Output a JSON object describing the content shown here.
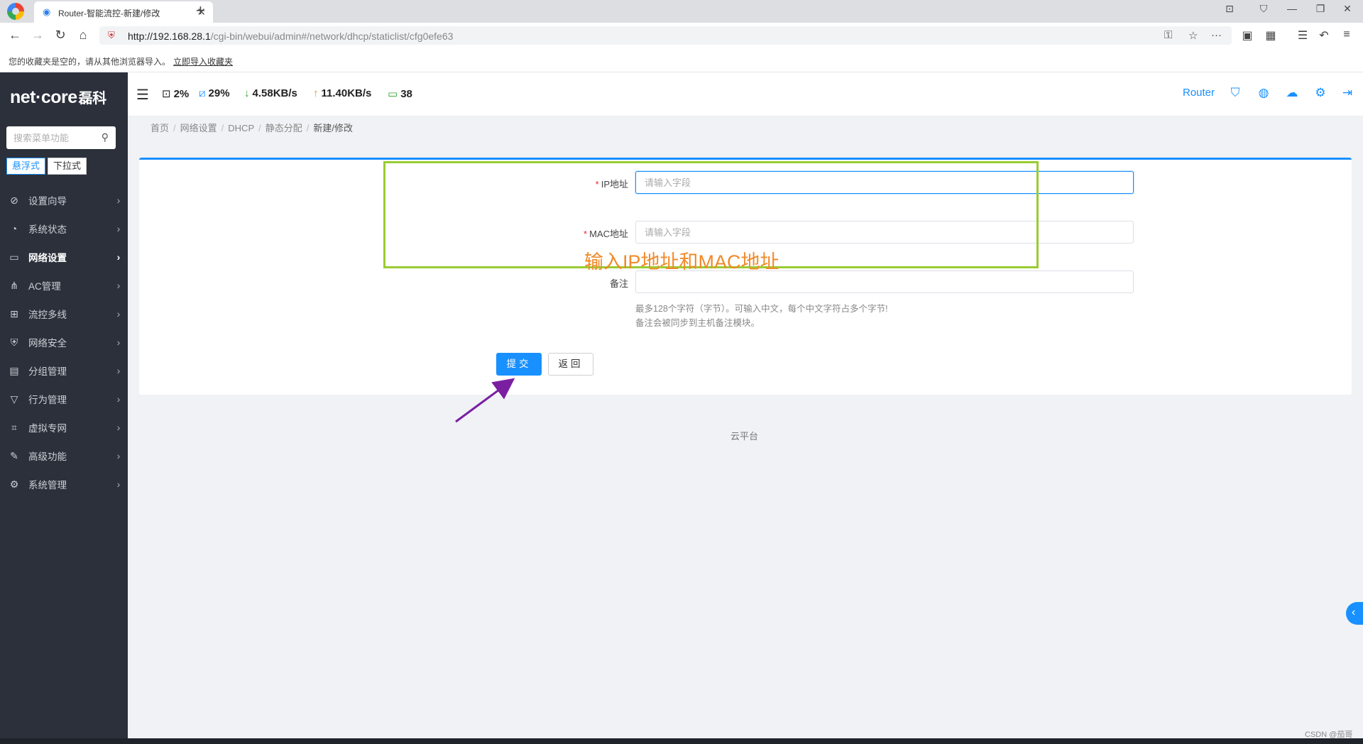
{
  "browser": {
    "tab_title": "Router-智能流控-新建/修改",
    "url_host": "http://192.168.28.1",
    "url_path": "/cgi-bin/webui/admin#/network/dhcp/staticlist/cfg0efe63",
    "bookmark_notice": "您的收藏夹是空的，请从其他浏览器导入。",
    "bookmark_import_link": "立即导入收藏夹"
  },
  "sidebar": {
    "logo": "net·core",
    "logo_cn": "磊科",
    "search_placeholder": "搜索菜单功能",
    "mode_float": "悬浮式",
    "mode_dropdown": "下拉式",
    "items": [
      {
        "label": "设置向导",
        "icon": "compass-icon"
      },
      {
        "label": "系统状态",
        "icon": "dashboard-icon"
      },
      {
        "label": "网络设置",
        "icon": "monitor-icon"
      },
      {
        "label": "AC管理",
        "icon": "ac-network-icon"
      },
      {
        "label": "流控多线",
        "icon": "multiline-icon"
      },
      {
        "label": "网络安全",
        "icon": "shield-icon"
      },
      {
        "label": "分组管理",
        "icon": "group-icon"
      },
      {
        "label": "行为管理",
        "icon": "filter-icon"
      },
      {
        "label": "虚拟专网",
        "icon": "vpn-icon"
      },
      {
        "label": "高级功能",
        "icon": "pin-icon"
      },
      {
        "label": "系统管理",
        "icon": "gear-icon"
      }
    ]
  },
  "header": {
    "cpu": "2%",
    "mem": "29%",
    "download": "4.58KB/s",
    "upload": "11.40KB/s",
    "clients": "38",
    "device_name": "Router"
  },
  "breadcrumb": [
    "首页",
    "网络设置",
    "DHCP",
    "静态分配",
    "新建/修改"
  ],
  "form": {
    "ip_label": "IP地址",
    "ip_placeholder": "请输入字段",
    "mac_label": "MAC地址",
    "mac_placeholder": "请输入字段",
    "note_label": "备注",
    "note_hint_1": "最多128个字符（字节）。可输入中文，每个中文字符占多个字节!",
    "note_hint_2": "备注会被同步到主机备注模块。",
    "submit_label": "提交",
    "back_label": "返回"
  },
  "annotation": {
    "text": "输入IP地址和MAC地址",
    "box_color": "#99cc33",
    "text_color": "#f08a2a",
    "arrow_color": "#7b1fa2"
  },
  "footer": "云平台",
  "watermark": "CSDN @茄哥",
  "colors": {
    "accent": "#1890ff",
    "sidebar_bg": "#2b303b",
    "required": "#f5222d"
  }
}
